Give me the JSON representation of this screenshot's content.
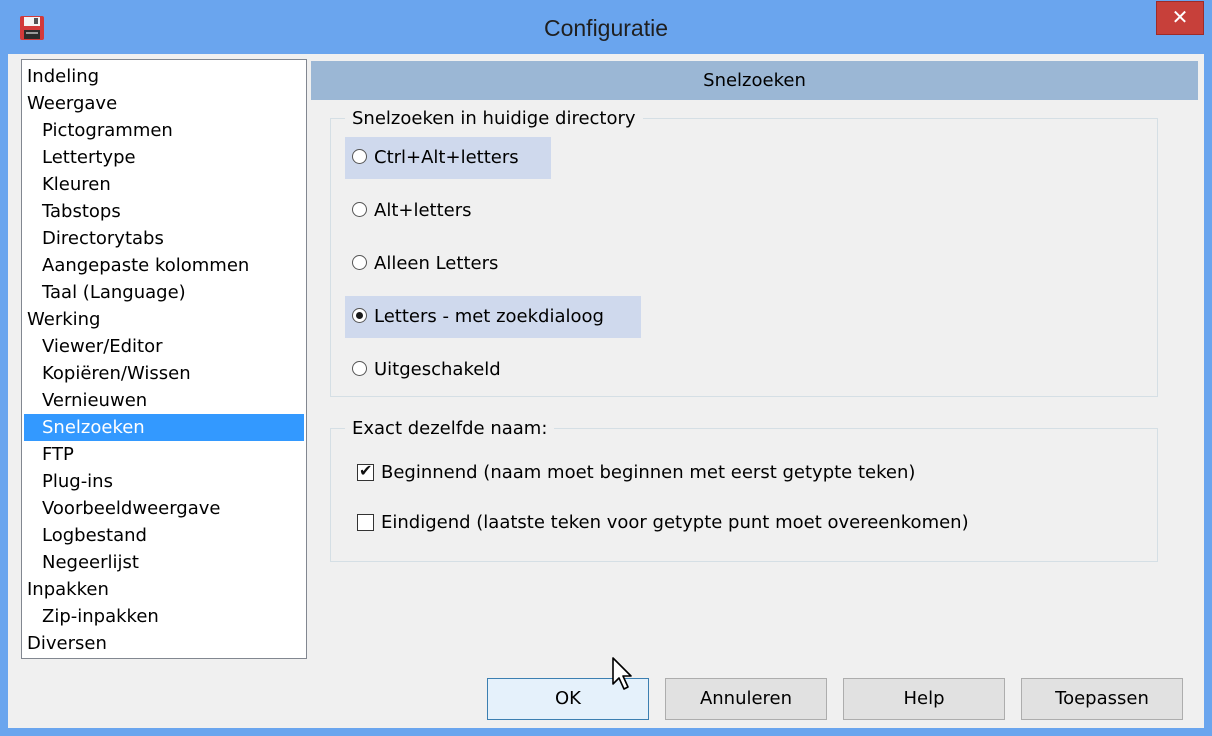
{
  "window": {
    "title": "Configuratie",
    "close_label": "✕",
    "app_icon": "floppy-disk-icon"
  },
  "tree": {
    "items": [
      {
        "label": "Indeling",
        "level": 0,
        "selected": false
      },
      {
        "label": "Weergave",
        "level": 0,
        "selected": false
      },
      {
        "label": "Pictogrammen",
        "level": 1,
        "selected": false
      },
      {
        "label": "Lettertype",
        "level": 1,
        "selected": false
      },
      {
        "label": "Kleuren",
        "level": 1,
        "selected": false
      },
      {
        "label": "Tabstops",
        "level": 1,
        "selected": false
      },
      {
        "label": "Directorytabs",
        "level": 1,
        "selected": false
      },
      {
        "label": "Aangepaste kolommen",
        "level": 1,
        "selected": false
      },
      {
        "label": "Taal (Language)",
        "level": 1,
        "selected": false
      },
      {
        "label": "Werking",
        "level": 0,
        "selected": false
      },
      {
        "label": "Viewer/Editor",
        "level": 1,
        "selected": false
      },
      {
        "label": "Kopiëren/Wissen",
        "level": 1,
        "selected": false
      },
      {
        "label": "Vernieuwen",
        "level": 1,
        "selected": false
      },
      {
        "label": "Snelzoeken",
        "level": 1,
        "selected": true
      },
      {
        "label": "FTP",
        "level": 1,
        "selected": false
      },
      {
        "label": "Plug-ins",
        "level": 1,
        "selected": false
      },
      {
        "label": "Voorbeeldweergave",
        "level": 1,
        "selected": false
      },
      {
        "label": "Logbestand",
        "level": 1,
        "selected": false
      },
      {
        "label": "Negeerlijst",
        "level": 1,
        "selected": false
      },
      {
        "label": "Inpakken",
        "level": 0,
        "selected": false
      },
      {
        "label": "Zip-inpakken",
        "level": 1,
        "selected": false
      },
      {
        "label": "Diversen",
        "level": 0,
        "selected": false
      }
    ]
  },
  "panel": {
    "header": "Snelzoeken",
    "quicksearch": {
      "legend": "Snelzoeken in huidige directory",
      "options": [
        {
          "label": "Ctrl+Alt+letters",
          "checked": false,
          "highlighted": true
        },
        {
          "label": "Alt+letters",
          "checked": false,
          "highlighted": false
        },
        {
          "label": "Alleen Letters",
          "checked": false,
          "highlighted": false
        },
        {
          "label": "Letters - met zoekdialoog",
          "checked": true,
          "highlighted": true
        },
        {
          "label": "Uitgeschakeld",
          "checked": false,
          "highlighted": false
        }
      ]
    },
    "exact": {
      "legend": "Exact dezelfde naam:",
      "checks": [
        {
          "label": "Beginnend (naam moet beginnen met eerst getypte teken)",
          "checked": true
        },
        {
          "label": "Eindigend (laatste teken voor getypte punt moet overeenkomen)",
          "checked": false
        }
      ]
    }
  },
  "buttons": {
    "ok": "OK",
    "cancel": "Annuleren",
    "help": "Help",
    "apply": "Toepassen"
  }
}
